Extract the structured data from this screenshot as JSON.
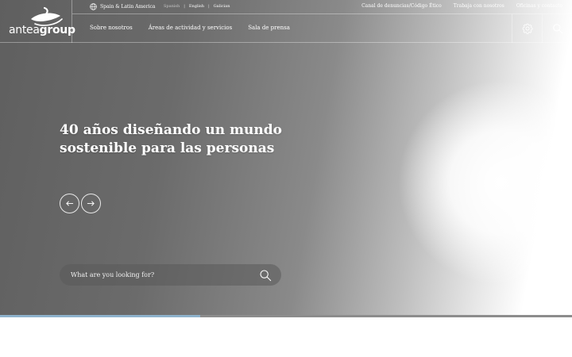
{
  "logo": {
    "brand_light": "antea",
    "brand_bold": "group"
  },
  "topbar": {
    "region": "Spain & Latin America",
    "languages": [
      {
        "label": "Spanish",
        "active": true
      },
      {
        "label": "English",
        "active": false
      },
      {
        "label": "Galician",
        "active": false
      }
    ],
    "separator": "|",
    "links": [
      "Canal de denuncias/Código Ético",
      "Trabaja con nosotros",
      "Oficinas y contacto"
    ]
  },
  "nav": {
    "items": [
      "Sobre nosotros",
      "Áreas de actividad y servicios",
      "Sala de prensa"
    ],
    "icons": {
      "settings": "gear-icon",
      "search": "search-icon"
    }
  },
  "hero": {
    "headline_line1": "40 años diseñando un mundo",
    "headline_line2": "sostenible para las personas"
  },
  "search": {
    "placeholder": "What are you looking for?"
  },
  "slider": {
    "progress": 0.35
  },
  "colors": {
    "accent": "#8eb2cc",
    "track": "#8c8c8c"
  }
}
